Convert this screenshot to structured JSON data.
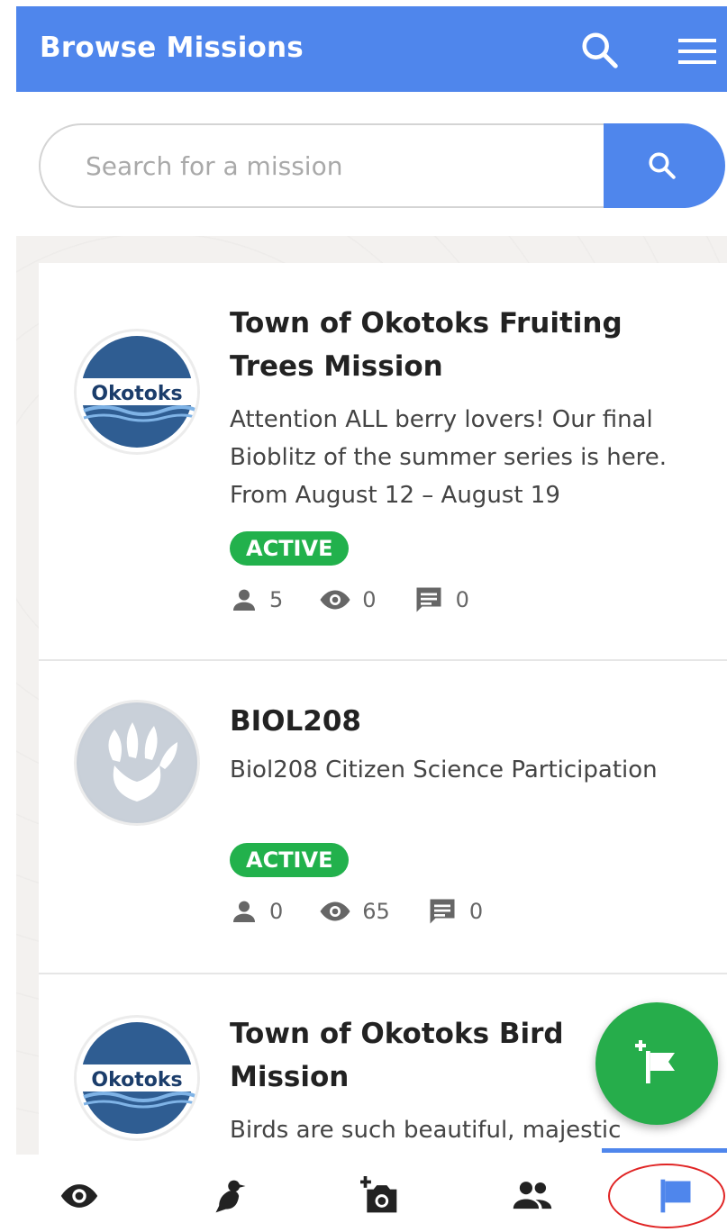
{
  "header": {
    "title": "Browse Missions"
  },
  "search": {
    "placeholder": "Search for a mission",
    "value": ""
  },
  "missions": [
    {
      "logo_text": "Okotoks",
      "title": "Town of Okotoks Fruiting Trees Mission",
      "description": "Attention ALL berry lovers! Our final Bioblitz of the summer series is here. From August 12 – August 19",
      "status": "ACTIVE",
      "participants": "5",
      "views": "0",
      "comments": "0"
    },
    {
      "title": "BIOL208",
      "description": "Biol208 Citizen Science Participation",
      "status": "ACTIVE",
      "participants": "0",
      "views": "65",
      "comments": "0"
    },
    {
      "logo_text": "Okotoks",
      "title": "Town of Okotoks Bird Mission",
      "description": "Birds are such beautiful, majestic"
    }
  ],
  "bottom_nav": {
    "items": [
      "eye-icon",
      "bird-icon",
      "add-photo-icon",
      "people-icon",
      "flag-icon"
    ],
    "active": "flag-icon"
  },
  "colors": {
    "primary": "#4f86ec",
    "active_badge": "#22b14c",
    "fab": "#26ad4b",
    "highlight_ring": "#e02424"
  }
}
